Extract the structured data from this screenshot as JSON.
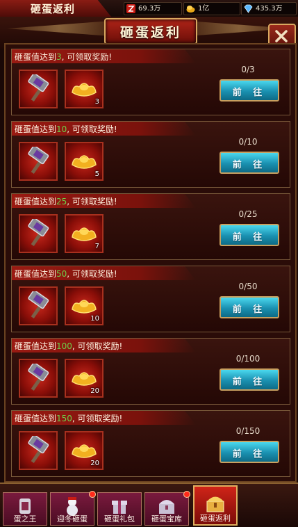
{
  "topbar": {
    "tab_label": "砸蛋返利",
    "resources": [
      {
        "icon": "zeal-icon",
        "value": "69.3万"
      },
      {
        "icon": "gold-coin-icon",
        "value": "1亿"
      },
      {
        "icon": "diamond-icon",
        "value": "435.3万"
      }
    ]
  },
  "header": {
    "title": "砸蛋返利",
    "close_icon": "close-icon"
  },
  "tasks": [
    {
      "prefix": "砸蛋值达到",
      "target": "3",
      "suffix": ", 可领取奖励!",
      "progress": "0/3",
      "button": "前 往",
      "rewards": [
        {
          "icon": "hammer-icon",
          "count": ""
        },
        {
          "icon": "gold-ingot-icon",
          "count": "3"
        }
      ]
    },
    {
      "prefix": "砸蛋值达到",
      "target": "10",
      "suffix": ", 可领取奖励!",
      "progress": "0/10",
      "button": "前 往",
      "rewards": [
        {
          "icon": "hammer-icon",
          "count": ""
        },
        {
          "icon": "gold-ingot-icon",
          "count": "5"
        }
      ]
    },
    {
      "prefix": "砸蛋值达到",
      "target": "25",
      "suffix": ", 可领取奖励!",
      "progress": "0/25",
      "button": "前 往",
      "rewards": [
        {
          "icon": "hammer-icon",
          "count": ""
        },
        {
          "icon": "gold-ingot-icon",
          "count": "7"
        }
      ]
    },
    {
      "prefix": "砸蛋值达到",
      "target": "50",
      "suffix": ", 可领取奖励!",
      "progress": "0/50",
      "button": "前 往",
      "rewards": [
        {
          "icon": "hammer-icon",
          "count": ""
        },
        {
          "icon": "gold-ingot-icon",
          "count": "10"
        }
      ]
    },
    {
      "prefix": "砸蛋值达到",
      "target": "100",
      "suffix": ", 可领取奖励!",
      "progress": "0/100",
      "button": "前 往",
      "rewards": [
        {
          "icon": "hammer-icon",
          "count": ""
        },
        {
          "icon": "gold-ingot-icon",
          "count": "20"
        }
      ]
    },
    {
      "prefix": "砸蛋值达到",
      "target": "150",
      "suffix": ", 可领取奖励!",
      "progress": "0/150",
      "button": "前 往",
      "rewards": [
        {
          "icon": "hammer-icon",
          "count": ""
        },
        {
          "icon": "gold-ingot-icon",
          "count": "20"
        }
      ]
    }
  ],
  "bottom_tabs": [
    {
      "label": "蛋之王",
      "icon": "egg-king-icon",
      "active": false,
      "badge": false
    },
    {
      "label": "迎冬砸蛋",
      "icon": "snowman-icon",
      "active": false,
      "badge": true
    },
    {
      "label": "砸蛋礼包",
      "icon": "gift-box-icon",
      "active": false,
      "badge": false
    },
    {
      "label": "砸蛋宝库",
      "icon": "treasure-chest-icon",
      "active": false,
      "badge": true
    },
    {
      "label": "砸蛋返利",
      "icon": "rebate-chest-icon",
      "active": true,
      "badge": false
    }
  ],
  "colors": {
    "target_number": "#6dd04a",
    "go_button": "#1a90b0",
    "active_tab": "#d02418"
  }
}
